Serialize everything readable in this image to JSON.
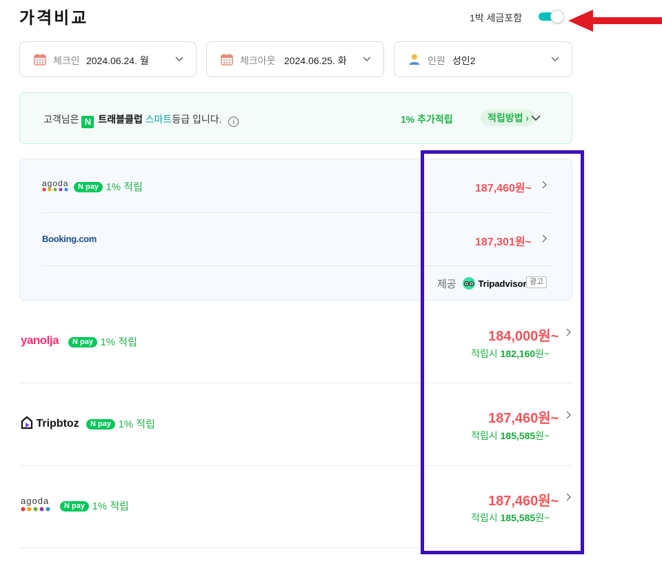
{
  "header": {
    "title": "가격비교",
    "tax_toggle_label": "1박 세금포함",
    "tax_toggle_on": true
  },
  "search": {
    "checkin": {
      "label": "체크인",
      "value": "2024.06.24. 월"
    },
    "checkout": {
      "label": "체크아웃",
      "value": "2024.06.25. 화"
    },
    "guests": {
      "label": "인원",
      "value": "성인2"
    }
  },
  "promo": {
    "prefix": "고객님은",
    "badge": "N",
    "brand": "트래블클럽",
    "grade": "스마트",
    "suffix": "등급 입니다.",
    "info_icon": "i",
    "extra_points": "1% 추가적립",
    "method_label": "적립방법 ›"
  },
  "grouped_offers": {
    "offers": [
      {
        "provider": "agoda",
        "npay": "pay",
        "npay_mark": "N",
        "points": "1% 적립",
        "price": "187,460원~"
      },
      {
        "provider": "Booking.com",
        "price": "187,301원~"
      }
    ],
    "provided_by_label": "제공",
    "provider_brand": "Tripadvisor",
    "ad_label": "광고"
  },
  "offers": [
    {
      "provider": "yanolja",
      "npay": "pay",
      "npay_mark": "N",
      "points": "1% 적립",
      "price": "184,000원~",
      "earn_prefix": "적립시",
      "earn_price": "182,160",
      "earn_suffix": "원~"
    },
    {
      "provider": "Tripbtoz",
      "npay": "pay",
      "npay_mark": "N",
      "points": "1% 적립",
      "price": "187,460원~",
      "earn_prefix": "적립시",
      "earn_price": "185,585",
      "earn_suffix": "원~"
    },
    {
      "provider": "agoda",
      "npay": "pay",
      "npay_mark": "N",
      "points": "1% 적립",
      "price": "187,460원~",
      "earn_prefix": "적립시",
      "earn_price": "185,585",
      "earn_suffix": "원~"
    }
  ],
  "colors": {
    "price_red": "#f0555a",
    "earn_green": "#21b24a",
    "toggle_teal": "#00c0c0",
    "annotation_arrow": "#e01b24",
    "annotation_box": "#3a0fc0"
  },
  "icons": [
    "calendar-icon",
    "person-icon",
    "chevron-down-icon",
    "info-icon",
    "chevron-right-icon"
  ]
}
